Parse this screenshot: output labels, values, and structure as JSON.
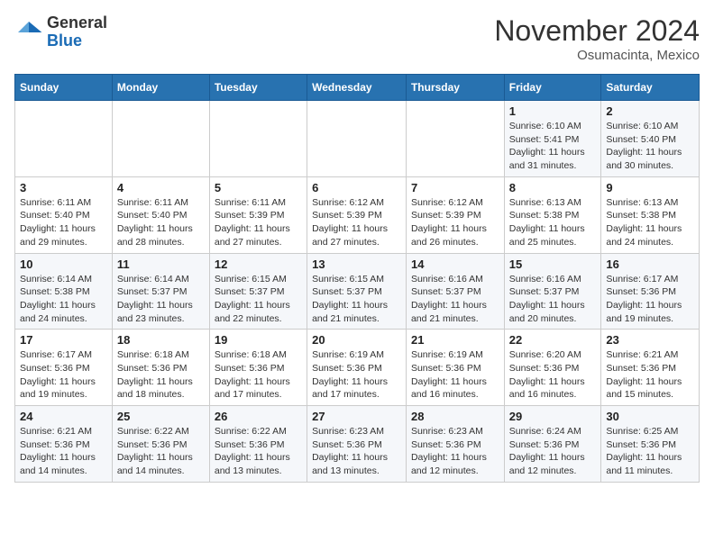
{
  "header": {
    "logo_line1": "General",
    "logo_line2": "Blue",
    "month": "November 2024",
    "location": "Osumacinta, Mexico"
  },
  "days_of_week": [
    "Sunday",
    "Monday",
    "Tuesday",
    "Wednesday",
    "Thursday",
    "Friday",
    "Saturday"
  ],
  "weeks": [
    [
      {
        "day": "",
        "info": ""
      },
      {
        "day": "",
        "info": ""
      },
      {
        "day": "",
        "info": ""
      },
      {
        "day": "",
        "info": ""
      },
      {
        "day": "",
        "info": ""
      },
      {
        "day": "1",
        "info": "Sunrise: 6:10 AM\nSunset: 5:41 PM\nDaylight: 11 hours\nand 31 minutes."
      },
      {
        "day": "2",
        "info": "Sunrise: 6:10 AM\nSunset: 5:40 PM\nDaylight: 11 hours\nand 30 minutes."
      }
    ],
    [
      {
        "day": "3",
        "info": "Sunrise: 6:11 AM\nSunset: 5:40 PM\nDaylight: 11 hours\nand 29 minutes."
      },
      {
        "day": "4",
        "info": "Sunrise: 6:11 AM\nSunset: 5:40 PM\nDaylight: 11 hours\nand 28 minutes."
      },
      {
        "day": "5",
        "info": "Sunrise: 6:11 AM\nSunset: 5:39 PM\nDaylight: 11 hours\nand 27 minutes."
      },
      {
        "day": "6",
        "info": "Sunrise: 6:12 AM\nSunset: 5:39 PM\nDaylight: 11 hours\nand 27 minutes."
      },
      {
        "day": "7",
        "info": "Sunrise: 6:12 AM\nSunset: 5:39 PM\nDaylight: 11 hours\nand 26 minutes."
      },
      {
        "day": "8",
        "info": "Sunrise: 6:13 AM\nSunset: 5:38 PM\nDaylight: 11 hours\nand 25 minutes."
      },
      {
        "day": "9",
        "info": "Sunrise: 6:13 AM\nSunset: 5:38 PM\nDaylight: 11 hours\nand 24 minutes."
      }
    ],
    [
      {
        "day": "10",
        "info": "Sunrise: 6:14 AM\nSunset: 5:38 PM\nDaylight: 11 hours\nand 24 minutes."
      },
      {
        "day": "11",
        "info": "Sunrise: 6:14 AM\nSunset: 5:37 PM\nDaylight: 11 hours\nand 23 minutes."
      },
      {
        "day": "12",
        "info": "Sunrise: 6:15 AM\nSunset: 5:37 PM\nDaylight: 11 hours\nand 22 minutes."
      },
      {
        "day": "13",
        "info": "Sunrise: 6:15 AM\nSunset: 5:37 PM\nDaylight: 11 hours\nand 21 minutes."
      },
      {
        "day": "14",
        "info": "Sunrise: 6:16 AM\nSunset: 5:37 PM\nDaylight: 11 hours\nand 21 minutes."
      },
      {
        "day": "15",
        "info": "Sunrise: 6:16 AM\nSunset: 5:37 PM\nDaylight: 11 hours\nand 20 minutes."
      },
      {
        "day": "16",
        "info": "Sunrise: 6:17 AM\nSunset: 5:36 PM\nDaylight: 11 hours\nand 19 minutes."
      }
    ],
    [
      {
        "day": "17",
        "info": "Sunrise: 6:17 AM\nSunset: 5:36 PM\nDaylight: 11 hours\nand 19 minutes."
      },
      {
        "day": "18",
        "info": "Sunrise: 6:18 AM\nSunset: 5:36 PM\nDaylight: 11 hours\nand 18 minutes."
      },
      {
        "day": "19",
        "info": "Sunrise: 6:18 AM\nSunset: 5:36 PM\nDaylight: 11 hours\nand 17 minutes."
      },
      {
        "day": "20",
        "info": "Sunrise: 6:19 AM\nSunset: 5:36 PM\nDaylight: 11 hours\nand 17 minutes."
      },
      {
        "day": "21",
        "info": "Sunrise: 6:19 AM\nSunset: 5:36 PM\nDaylight: 11 hours\nand 16 minutes."
      },
      {
        "day": "22",
        "info": "Sunrise: 6:20 AM\nSunset: 5:36 PM\nDaylight: 11 hours\nand 16 minutes."
      },
      {
        "day": "23",
        "info": "Sunrise: 6:21 AM\nSunset: 5:36 PM\nDaylight: 11 hours\nand 15 minutes."
      }
    ],
    [
      {
        "day": "24",
        "info": "Sunrise: 6:21 AM\nSunset: 5:36 PM\nDaylight: 11 hours\nand 14 minutes."
      },
      {
        "day": "25",
        "info": "Sunrise: 6:22 AM\nSunset: 5:36 PM\nDaylight: 11 hours\nand 14 minutes."
      },
      {
        "day": "26",
        "info": "Sunrise: 6:22 AM\nSunset: 5:36 PM\nDaylight: 11 hours\nand 13 minutes."
      },
      {
        "day": "27",
        "info": "Sunrise: 6:23 AM\nSunset: 5:36 PM\nDaylight: 11 hours\nand 13 minutes."
      },
      {
        "day": "28",
        "info": "Sunrise: 6:23 AM\nSunset: 5:36 PM\nDaylight: 11 hours\nand 12 minutes."
      },
      {
        "day": "29",
        "info": "Sunrise: 6:24 AM\nSunset: 5:36 PM\nDaylight: 11 hours\nand 12 minutes."
      },
      {
        "day": "30",
        "info": "Sunrise: 6:25 AM\nSunset: 5:36 PM\nDaylight: 11 hours\nand 11 minutes."
      }
    ]
  ]
}
